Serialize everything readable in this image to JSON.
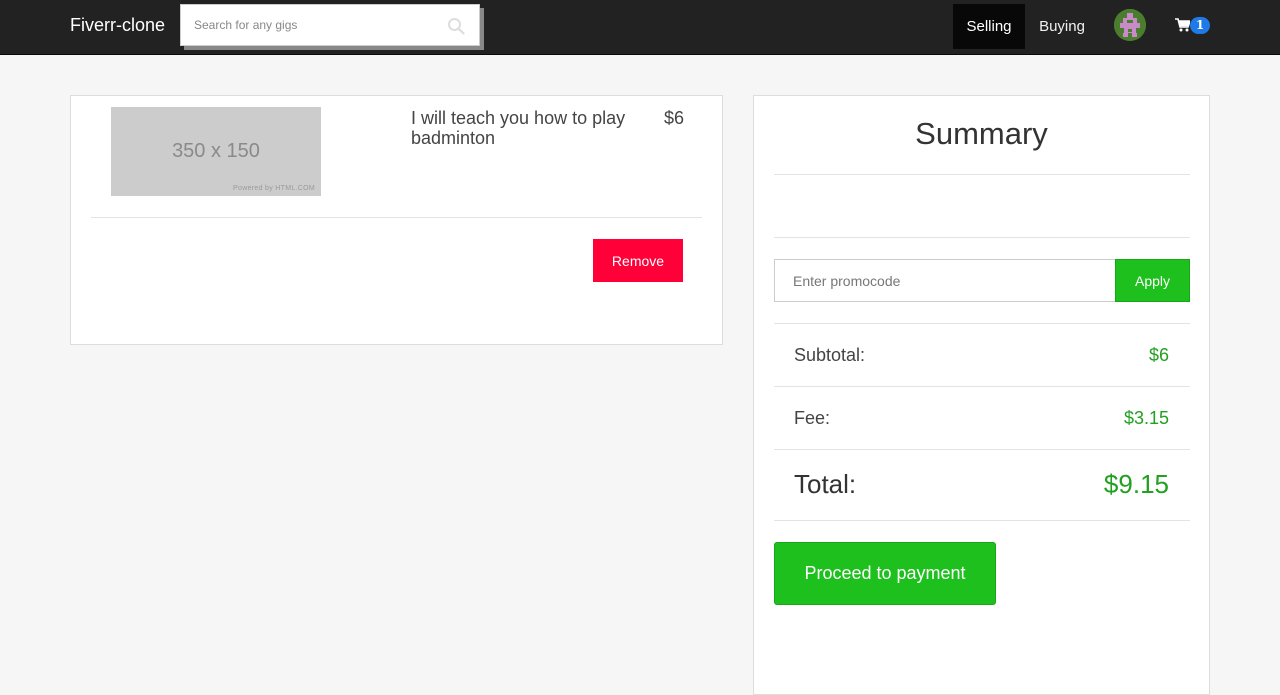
{
  "navbar": {
    "brand": "Fiverr-clone",
    "search_placeholder": "Search for any gigs",
    "nav_selling": "Selling",
    "nav_buying": "Buying",
    "cart_count": "1",
    "icons": {
      "search": "search-icon",
      "avatar": "avatar",
      "cart": "cart-icon"
    }
  },
  "cart": {
    "items": [
      {
        "thumbnail_text": "350 x 150",
        "thumbnail_powered": "Powered by HTML.COM",
        "title": "I will teach you how to play badminton",
        "price": "$6",
        "remove_label": "Remove"
      }
    ]
  },
  "summary": {
    "title": "Summary",
    "promo_placeholder": "Enter promocode",
    "apply_label": "Apply",
    "subtotal_label": "Subtotal:",
    "subtotal_value": "$6",
    "fee_label": "Fee:",
    "fee_value": "$3.15",
    "total_label": "Total:",
    "total_value": "$9.15",
    "pay_label": "Proceed to payment"
  },
  "colors": {
    "navbar_bg": "#222222",
    "accent_green": "#1dc01d",
    "price_green": "#22a020",
    "remove_red": "#ff0039",
    "badge_blue": "#1e7ae6"
  }
}
